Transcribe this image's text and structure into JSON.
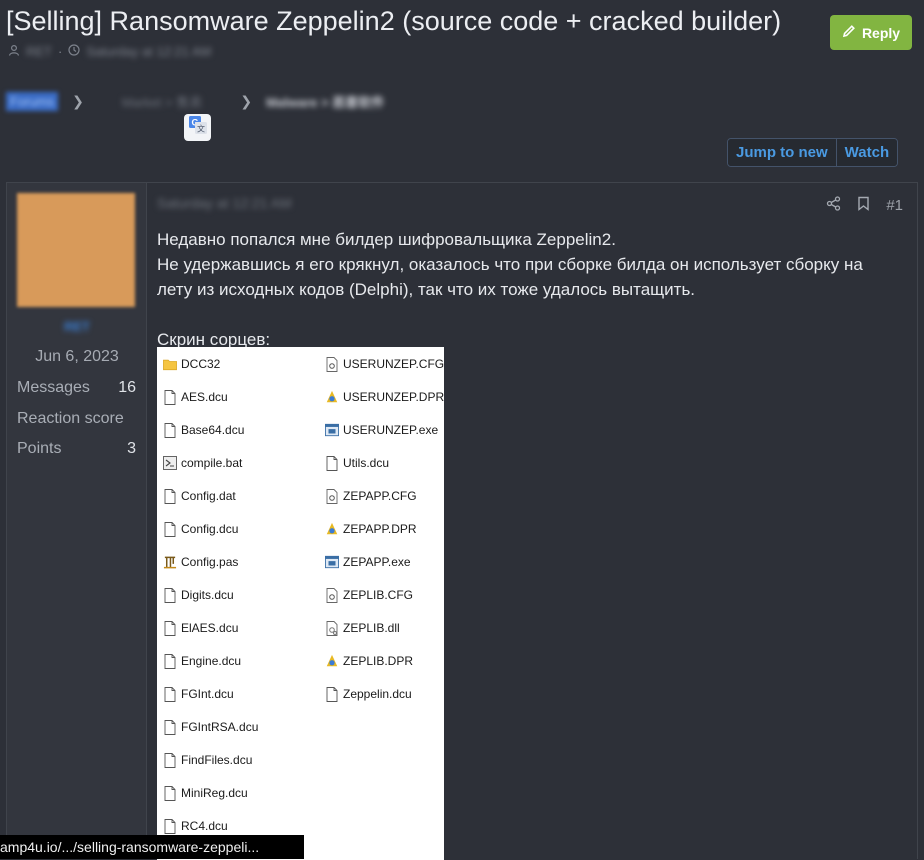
{
  "thread": {
    "title": "[Selling] Ransomware Zeppelin2 (source code + cracked builder)",
    "author": "RET",
    "date": "Saturday at 12:21 AM",
    "reply_label": "Reply"
  },
  "breadcrumbs": [
    "Forums",
    "Market > 售卖",
    "Malware > 恶意软件"
  ],
  "thread_buttons": {
    "jump_label": "Jump to new",
    "watch_label": "Watch"
  },
  "post": {
    "date": "Saturday at 12:21 AM",
    "number": "#1",
    "body_lines": [
      "Недавно попался мне билдер шифровальщика Zeppelin2.",
      "Не удержавшись я его крякнул, оказалось что при сборке билда он использует сборку на",
      "лету из исходных кодов (Delphi), так что их тоже удалось вытащить.",
      "Скрин сорцев:"
    ]
  },
  "user": {
    "name": "RET",
    "joined": "Jun 6, 2023",
    "stats": [
      {
        "label": "Messages",
        "value": "16"
      },
      {
        "label": "Reaction score",
        "value": ""
      },
      {
        "label": "Points",
        "value": "3"
      }
    ]
  },
  "screenshot_files": {
    "left": [
      {
        "name": "DCC32",
        "icon": "folder-icon"
      },
      {
        "name": "AES.dcu",
        "icon": "file-icon"
      },
      {
        "name": "Base64.dcu",
        "icon": "file-icon"
      },
      {
        "name": "compile.bat",
        "icon": "bat-icon"
      },
      {
        "name": "Config.dat",
        "icon": "file-icon"
      },
      {
        "name": "Config.dcu",
        "icon": "file-icon"
      },
      {
        "name": "Config.pas",
        "icon": "pas-icon"
      },
      {
        "name": "Digits.dcu",
        "icon": "file-icon"
      },
      {
        "name": "ElAES.dcu",
        "icon": "file-icon"
      },
      {
        "name": "Engine.dcu",
        "icon": "file-icon"
      },
      {
        "name": "FGInt.dcu",
        "icon": "file-icon"
      },
      {
        "name": "FGIntRSA.dcu",
        "icon": "file-icon"
      },
      {
        "name": "FindFiles.dcu",
        "icon": "file-icon"
      },
      {
        "name": "MiniReg.dcu",
        "icon": "file-icon"
      },
      {
        "name": "RC4.dcu",
        "icon": "file-icon"
      }
    ],
    "right": [
      {
        "name": "USERUNZEP.CFG",
        "icon": "cfg-icon"
      },
      {
        "name": "USERUNZEP.DPR",
        "icon": "dpr-icon"
      },
      {
        "name": "USERUNZEP.exe",
        "icon": "exe-icon"
      },
      {
        "name": "Utils.dcu",
        "icon": "file-icon"
      },
      {
        "name": "ZEPAPP.CFG",
        "icon": "cfg-icon"
      },
      {
        "name": "ZEPAPP.DPR",
        "icon": "dpr-icon"
      },
      {
        "name": "ZEPAPP.exe",
        "icon": "exe-icon"
      },
      {
        "name": "ZEPLIB.CFG",
        "icon": "cfg-icon"
      },
      {
        "name": "ZEPLIB.dll",
        "icon": "dll-icon"
      },
      {
        "name": "ZEPLIB.DPR",
        "icon": "dpr-icon"
      },
      {
        "name": "Zeppelin.dcu",
        "icon": "file-icon"
      }
    ]
  },
  "status_bar": {
    "url": "amp4u.io/.../selling-ransomware-zeppeli..."
  },
  "colors": {
    "accent": "#4a9ae2",
    "reply": "#82b541",
    "background": "#2d3038"
  }
}
